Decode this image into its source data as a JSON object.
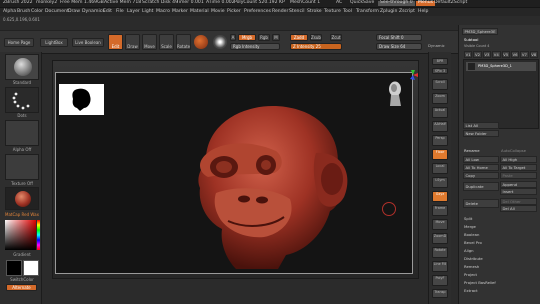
{
  "title_bar": {
    "app": "ZBrush 2022",
    "doc": "monkey2",
    "free_mem": "Free Mem 1.469GB",
    "active_mem": "Active Mem 718",
    "scratch": "Scratch Disk 49",
    "timer": "Timer 0.001",
    "atime": "ATime 0.002",
    "polycount": "PolyCount 520.192 KP",
    "meshcount": "MeshCount 1",
    "ac": "AC",
    "quicksave": "QuickSave",
    "see_through": "See-through 0",
    "menus": "Menus",
    "default_zscript": "DefaultZScript"
  },
  "menu_bar": [
    "Alpha",
    "Brush",
    "Color",
    "Document",
    "Draw",
    "Dynamics",
    "Edit",
    "File",
    "Layer",
    "Light",
    "Macro",
    "Marker",
    "Material",
    "Movie",
    "Picker",
    "Preferences",
    "Render",
    "Stencil",
    "Stroke",
    "Texture",
    "Tool",
    "Transform",
    "Zplugin",
    "Zscript",
    "Help"
  ],
  "coords": "0.625,0.196,0.601",
  "topbar": {
    "home_page": "Home Page",
    "lightbox": "LightBox",
    "live_boolean": "Live Boolean",
    "edit": "Edit",
    "draw": "Draw",
    "move": "Move",
    "scale": "Scale",
    "rotate": "Rotate",
    "a_label": "A",
    "mrgb": "Mrgb",
    "rgb": "Rgb",
    "m": "M",
    "zadd": "Zadd",
    "zsub": "Zsub",
    "zcut": "Zcut",
    "rgb_intensity": "Rgb Intensity",
    "z_intensity": "Z Intensity 25",
    "focal_shift": "Focal Shift 0",
    "draw_size": "Draw Size 64",
    "dynamic": "Dynamic"
  },
  "left_shelf": {
    "standard": "Standard",
    "dots": "Dots",
    "alpha_off": "Alpha Off",
    "texture_off": "Texture Off",
    "matcap": "MatCap Red Wax",
    "gradient": "Gradient",
    "switch_color": "SwitchColor",
    "alternate": "Alternate"
  },
  "right_shelf": [
    "BPR",
    "SPix 3",
    "Scroll",
    "Zoom",
    "Actual",
    "AAHalf",
    "Persp",
    "Floor",
    "Local",
    "LSym",
    "Gxyz",
    "Frame",
    "Move",
    "ZoomD",
    "Rotate",
    "Line Fill",
    "PolyF",
    "Transp",
    "Dynamic",
    "Solo",
    "Xpose"
  ],
  "tool_panel": {
    "subtool": "Subtool",
    "visible_count": "Visible Count 4",
    "v_buttons": [
      "V1",
      "V2",
      "V3",
      "V4",
      "V5",
      "V6",
      "V7",
      "V8"
    ],
    "subtool_name": "PM3D_Sphere3D_1",
    "tool_name": "PM3D_Sphere3E",
    "list_all": "List All",
    "new_folder": "New Folder",
    "auto_collapse": "AutoCollapse",
    "rename": "Rename",
    "all_low": "All Low",
    "all_high": "All High",
    "all_to_home": "All To Home",
    "all_to_target": "All To Target",
    "copy": "Copy",
    "paste": "Paste",
    "duplicate": "Duplicate",
    "append": "Append",
    "insert": "Insert",
    "delete": "Delete",
    "del_other": "Del Other",
    "del_all": "Del All",
    "sections": [
      "Split",
      "Merge",
      "Boolean",
      "Bevel Pro",
      "Align",
      "Distribute",
      "Remesh",
      "Project",
      "Project BasRelief",
      "Extract"
    ]
  },
  "colors": {
    "accent": "#d46a2a",
    "model": "#9e3224"
  }
}
